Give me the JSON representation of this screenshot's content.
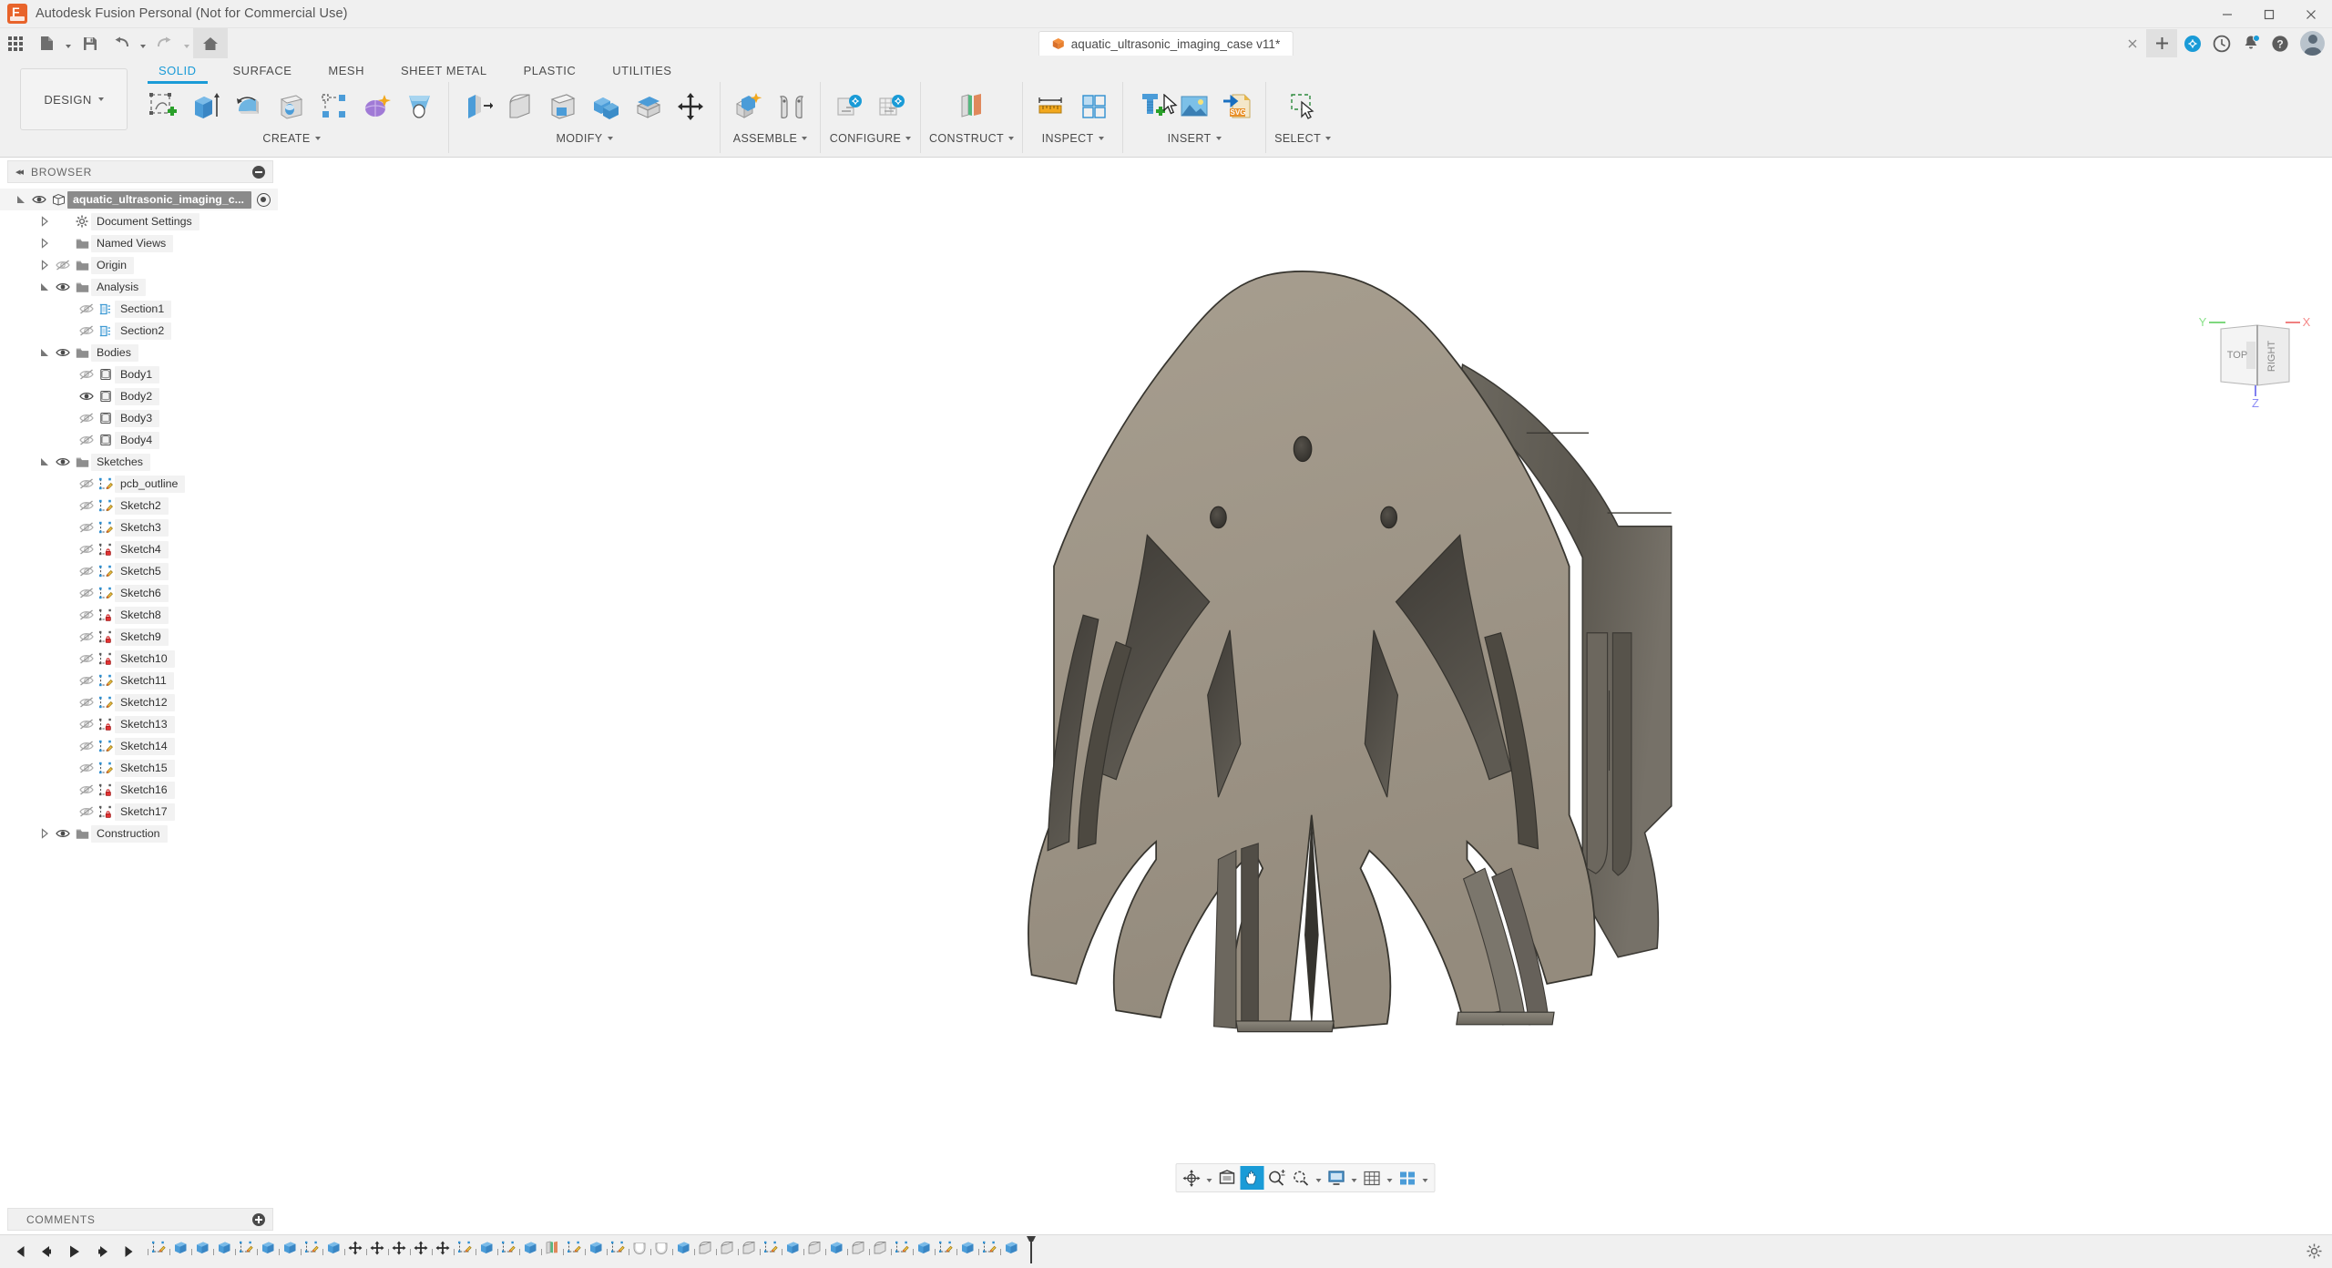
{
  "window": {
    "title": "Autodesk Fusion Personal (Not for Commercial Use)",
    "app_logo": "fusion-logo",
    "minimize": "—",
    "maximize": "□",
    "close": "✕"
  },
  "quick_access": {
    "items": [
      {
        "name": "app-grid",
        "icon": "grid-icon",
        "caret": false
      },
      {
        "name": "new-file",
        "icon": "file-icon",
        "caret": true
      },
      {
        "name": "save",
        "icon": "save-icon",
        "caret": false
      },
      {
        "name": "undo",
        "icon": "undo-arrow-icon",
        "caret": true
      },
      {
        "name": "redo",
        "icon": "redo-arrow-icon",
        "caret": true
      },
      {
        "name": "home",
        "icon": "home-icon",
        "caret": false
      }
    ],
    "doc_tab": {
      "label": "aquatic_ultrasonic_imaging_case v11*",
      "icon": "orange-cube-icon"
    },
    "tab_close": "✕",
    "tab_new": "+",
    "right_icons": [
      {
        "name": "extensions-icon",
        "label": "extensions"
      },
      {
        "name": "recent-clock-icon",
        "label": "recent"
      },
      {
        "name": "notifications-bell-icon",
        "label": "notifications",
        "badge": true
      },
      {
        "name": "help-icon",
        "label": "help"
      },
      {
        "name": "user-avatar",
        "label": "account"
      }
    ]
  },
  "ribbon": {
    "workspace": {
      "label": "DESIGN",
      "caret": "▾"
    },
    "tabs": [
      {
        "label": "SOLID",
        "active": true
      },
      {
        "label": "SURFACE",
        "active": false
      },
      {
        "label": "MESH",
        "active": false
      },
      {
        "label": "SHEET METAL",
        "active": false
      },
      {
        "label": "PLASTIC",
        "active": false
      },
      {
        "label": "UTILITIES",
        "active": false
      }
    ],
    "panels": [
      {
        "label": "CREATE",
        "caret": "▾",
        "tools": [
          "create-sketch-icon",
          "extrude-icon",
          "revolve-icon",
          "hole-icon",
          "pattern-icon",
          "form-icon",
          "loft-icon"
        ]
      },
      {
        "label": "MODIFY",
        "caret": "▾",
        "tools": [
          "press-pull-icon",
          "fillet-icon",
          "shell-icon",
          "combine-icon",
          "offset-face-icon",
          "move-copy-icon"
        ]
      },
      {
        "label": "ASSEMBLE",
        "caret": "▾",
        "tools": [
          "new-component-icon",
          "joint-icon"
        ]
      },
      {
        "label": "CONFIGURE",
        "caret": "▾",
        "tools": [
          "configuration-icon",
          "configuration-table-icon"
        ]
      },
      {
        "label": "CONSTRUCT",
        "caret": "▾",
        "tools": [
          "offset-plane-icon"
        ]
      },
      {
        "label": "INSPECT",
        "caret": "▾",
        "tools": [
          "measure-icon",
          "section-analysis-icon"
        ]
      },
      {
        "label": "INSERT",
        "caret": "▾",
        "tools": [
          "insert-mcmaster-icon",
          "insert-image-icon",
          "insert-svg-icon"
        ]
      },
      {
        "label": "SELECT",
        "caret": "▾",
        "tools": [
          "select-window-icon"
        ]
      }
    ]
  },
  "browser": {
    "header": {
      "title": "BROWSER",
      "collapse_icon": "collapse-left-icon",
      "toggle_icon": "minus-circle-icon"
    },
    "tree": [
      {
        "label": "aquatic_ultrasonic_imaging_c...",
        "depth": 0,
        "arrow": "expanded",
        "eye": "visible",
        "icon": "component-icon",
        "root": true,
        "activedot": true
      },
      {
        "label": "Document Settings",
        "depth": 1,
        "arrow": "collapsed",
        "eye": "none",
        "icon": "gear-icon"
      },
      {
        "label": "Named Views",
        "depth": 1,
        "arrow": "collapsed",
        "eye": "none",
        "icon": "folder-icon"
      },
      {
        "label": "Origin",
        "depth": 1,
        "arrow": "collapsed",
        "eye": "hidden",
        "icon": "folder-icon"
      },
      {
        "label": "Analysis",
        "depth": 1,
        "arrow": "expanded",
        "eye": "visible",
        "icon": "folder-icon"
      },
      {
        "label": "Section1",
        "depth": 2,
        "arrow": "none",
        "eye": "hidden",
        "icon": "section-icon"
      },
      {
        "label": "Section2",
        "depth": 2,
        "arrow": "none",
        "eye": "hidden",
        "icon": "section-icon"
      },
      {
        "label": "Bodies",
        "depth": 1,
        "arrow": "expanded",
        "eye": "visible",
        "icon": "folder-icon"
      },
      {
        "label": "Body1",
        "depth": 2,
        "arrow": "none",
        "eye": "hidden",
        "icon": "body-icon"
      },
      {
        "label": "Body2",
        "depth": 2,
        "arrow": "none",
        "eye": "visible",
        "icon": "body-icon"
      },
      {
        "label": "Body3",
        "depth": 2,
        "arrow": "none",
        "eye": "hidden",
        "icon": "body-icon"
      },
      {
        "label": "Body4",
        "depth": 2,
        "arrow": "none",
        "eye": "hidden",
        "icon": "body-icon"
      },
      {
        "label": "Sketches",
        "depth": 1,
        "arrow": "expanded",
        "eye": "visible",
        "icon": "folder-icon"
      },
      {
        "label": "pcb_outline",
        "depth": 2,
        "arrow": "none",
        "eye": "hidden",
        "icon": "sketch-edit-icon"
      },
      {
        "label": "Sketch2",
        "depth": 2,
        "arrow": "none",
        "eye": "hidden",
        "icon": "sketch-edit-icon"
      },
      {
        "label": "Sketch3",
        "depth": 2,
        "arrow": "none",
        "eye": "hidden",
        "icon": "sketch-edit-icon"
      },
      {
        "label": "Sketch4",
        "depth": 2,
        "arrow": "none",
        "eye": "hidden",
        "icon": "sketch-lock-icon"
      },
      {
        "label": "Sketch5",
        "depth": 2,
        "arrow": "none",
        "eye": "hidden",
        "icon": "sketch-edit-icon"
      },
      {
        "label": "Sketch6",
        "depth": 2,
        "arrow": "none",
        "eye": "hidden",
        "icon": "sketch-edit-icon"
      },
      {
        "label": "Sketch8",
        "depth": 2,
        "arrow": "none",
        "eye": "hidden",
        "icon": "sketch-lock-icon"
      },
      {
        "label": "Sketch9",
        "depth": 2,
        "arrow": "none",
        "eye": "hidden",
        "icon": "sketch-lock-icon"
      },
      {
        "label": "Sketch10",
        "depth": 2,
        "arrow": "none",
        "eye": "hidden",
        "icon": "sketch-lock-icon"
      },
      {
        "label": "Sketch11",
        "depth": 2,
        "arrow": "none",
        "eye": "hidden",
        "icon": "sketch-edit-icon"
      },
      {
        "label": "Sketch12",
        "depth": 2,
        "arrow": "none",
        "eye": "hidden",
        "icon": "sketch-edit-icon"
      },
      {
        "label": "Sketch13",
        "depth": 2,
        "arrow": "none",
        "eye": "hidden",
        "icon": "sketch-lock-icon"
      },
      {
        "label": "Sketch14",
        "depth": 2,
        "arrow": "none",
        "eye": "hidden",
        "icon": "sketch-edit-icon"
      },
      {
        "label": "Sketch15",
        "depth": 2,
        "arrow": "none",
        "eye": "hidden",
        "icon": "sketch-edit-icon"
      },
      {
        "label": "Sketch16",
        "depth": 2,
        "arrow": "none",
        "eye": "hidden",
        "icon": "sketch-lock-icon"
      },
      {
        "label": "Sketch17",
        "depth": 2,
        "arrow": "none",
        "eye": "hidden",
        "icon": "sketch-lock-icon"
      },
      {
        "label": "Construction",
        "depth": 1,
        "arrow": "collapsed",
        "eye": "visible",
        "icon": "folder-icon"
      }
    ]
  },
  "comments": {
    "title": "COMMENTS",
    "add_icon": "plus-circle-icon"
  },
  "canvas": {
    "background": "#ffffff",
    "model": {
      "name": "aquatic-ultrasonic-imaging-case-body",
      "front_face_color": "#9d9485",
      "side_face_color": "#55514a",
      "edge_color": "#3a3833",
      "description": "Octopus-shaped enclosure shell, isometric-ish front view"
    },
    "viewcube": {
      "top_label": "TOP",
      "right_label": "RIGHT",
      "axes": [
        {
          "label": "X",
          "color": "#f08080"
        },
        {
          "label": "Y",
          "color": "#7ed87e"
        },
        {
          "label": "Z",
          "color": "#8080f0"
        }
      ]
    },
    "navbar": [
      {
        "name": "orbit-icon",
        "caret": true,
        "active": false
      },
      {
        "name": "look-at-icon",
        "caret": false,
        "active": false
      },
      {
        "name": "pan-hand-icon",
        "caret": false,
        "active": true
      },
      {
        "name": "zoom-icon",
        "caret": false,
        "active": false
      },
      {
        "name": "fit-icon",
        "caret": true,
        "active": false
      },
      {
        "name": "display-settings-icon",
        "caret": true,
        "active": false
      },
      {
        "name": "grid-snap-icon",
        "caret": true,
        "active": false
      },
      {
        "name": "viewports-icon",
        "caret": true,
        "active": false
      }
    ]
  },
  "timeline": {
    "playback": [
      "jump-start-icon",
      "step-back-icon",
      "play-icon",
      "step-forward-icon",
      "jump-end-icon"
    ],
    "features": [
      "sketch-icon",
      "extrude-icon",
      "extrude-icon",
      "extrude-icon",
      "sketch-icon",
      "extrude-icon",
      "extrude-icon",
      "sketch-icon",
      "extrude-icon",
      "move-icon",
      "move-icon",
      "move-icon",
      "move-icon",
      "move-icon",
      "sketch-icon",
      "extrude-icon",
      "sketch-icon",
      "extrude-icon",
      "plane-icon",
      "sketch-icon",
      "extrude-icon",
      "sketch-icon",
      "revolve-icon",
      "revolve-icon",
      "extrude-icon",
      "fillet-icon",
      "fillet-icon",
      "fillet-icon",
      "sketch-icon",
      "extrude-icon",
      "fillet-icon",
      "extrude-icon",
      "fillet-icon",
      "fillet-icon",
      "sketch-icon",
      "extrude-icon",
      "sketch-icon",
      "extrude-icon",
      "sketch-icon",
      "extrude-icon"
    ],
    "marker": "timeline-end-marker",
    "settings_icon": "gear-icon"
  }
}
